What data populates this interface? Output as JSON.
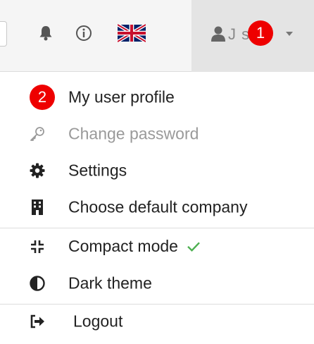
{
  "topbar": {
    "notification_icon": "bell-icon",
    "info_icon": "info-icon",
    "language_flag": "uk-flag-icon",
    "user_icon": "user-icon",
    "user_name": "J  s",
    "badge_1": "1"
  },
  "menu": {
    "badge_2": "2",
    "items": [
      {
        "label": "My user profile",
        "icon": ""
      },
      {
        "label": "Change password",
        "icon": "key-icon",
        "disabled": true
      },
      {
        "label": "Settings",
        "icon": "gear-icon"
      },
      {
        "label": "Choose default company",
        "icon": "building-icon"
      },
      {
        "label": "Compact mode",
        "icon": "compress-icon",
        "checked": true
      },
      {
        "label": "Dark theme",
        "icon": "half-circle-icon"
      },
      {
        "label": "Logout",
        "icon": "sign-out-icon"
      }
    ]
  },
  "colors": {
    "badge": "#ee0000",
    "check": "#4caf50",
    "disabled_text": "#9a9a9a"
  }
}
